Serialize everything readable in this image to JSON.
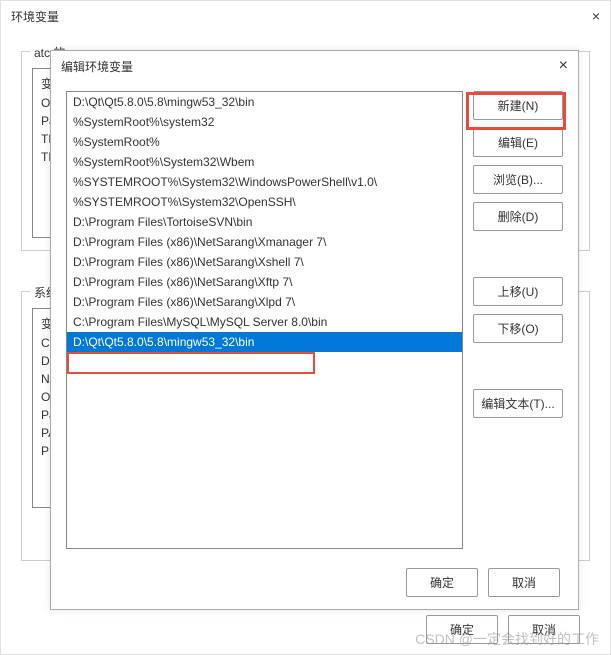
{
  "outer": {
    "title": "环境变量",
    "close": "×",
    "group1_label": "atc 的",
    "group2_label": "系统",
    "bg_items": [
      "变",
      "O",
      "Pa",
      "TE",
      "TN"
    ],
    "bg_items2": [
      "变",
      "Co",
      "D",
      "NU",
      "O",
      "Pa",
      "PA",
      "PR"
    ],
    "ok": "确定",
    "cancel": "取消"
  },
  "inner": {
    "title": "编辑环境变量",
    "close": "×",
    "paths": [
      "D:\\Qt\\Qt5.8.0\\5.8\\mingw53_32\\bin",
      "%SystemRoot%\\system32",
      "%SystemRoot%",
      "%SystemRoot%\\System32\\Wbem",
      "%SYSTEMROOT%\\System32\\WindowsPowerShell\\v1.0\\",
      "%SYSTEMROOT%\\System32\\OpenSSH\\",
      "D:\\Program Files\\TortoiseSVN\\bin",
      "D:\\Program Files (x86)\\NetSarang\\Xmanager 7\\",
      "D:\\Program Files (x86)\\NetSarang\\Xshell 7\\",
      "D:\\Program Files (x86)\\NetSarang\\Xftp 7\\",
      "D:\\Program Files (x86)\\NetSarang\\Xlpd 7\\",
      "C:\\Program Files\\MySQL\\MySQL Server 8.0\\bin",
      "D:\\Qt\\Qt5.8.0\\5.8\\mingw53_32\\bin"
    ],
    "selected_index": 12,
    "buttons": {
      "new": "新建(N)",
      "edit": "编辑(E)",
      "browse": "浏览(B)...",
      "delete": "删除(D)",
      "moveup": "上移(U)",
      "movedown": "下移(O)",
      "edittext": "编辑文本(T)..."
    },
    "ok": "确定",
    "cancel": "取消"
  },
  "watermark": "CSDN @一定会找到好的工作"
}
